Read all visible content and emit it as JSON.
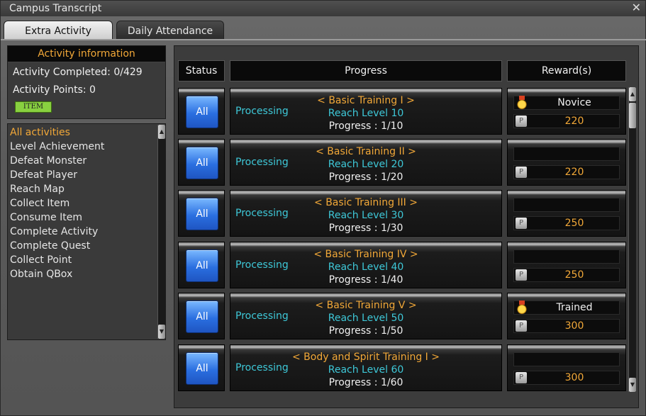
{
  "window": {
    "title": "Campus Transcript",
    "close_glyph": "✕"
  },
  "tabs": [
    {
      "label": "Extra Activity",
      "active": true
    },
    {
      "label": "Daily Attendance",
      "active": false
    }
  ],
  "info": {
    "header": "Activity information",
    "completed": "Activity Completed: 0/429",
    "points": "Activity Points: 0",
    "item_badge": "ITEM"
  },
  "categories": [
    "All activities",
    "Level Achievement",
    "Defeat Monster",
    "Defeat Player",
    "Reach Map",
    "Collect Item",
    "Consume Item",
    "Complete Activity",
    "Complete Quest",
    "Collect Point",
    "Obtain QBox"
  ],
  "table": {
    "headers": {
      "status": "Status",
      "progress": "Progress",
      "rewards": "Reward(s)"
    },
    "rows": [
      {
        "button": "All",
        "state": "Processing",
        "name": "< Basic Training I >",
        "goal": "Reach Level 10",
        "progress": "Progress : 1/10",
        "reward_title": "Novice",
        "reward_points": "220"
      },
      {
        "button": "All",
        "state": "Processing",
        "name": "< Basic Training II >",
        "goal": "Reach Level 20",
        "progress": "Progress : 1/20",
        "reward_title": "",
        "reward_points": "220"
      },
      {
        "button": "All",
        "state": "Processing",
        "name": "< Basic Training III >",
        "goal": "Reach Level 30",
        "progress": "Progress : 1/30",
        "reward_title": "",
        "reward_points": "250"
      },
      {
        "button": "All",
        "state": "Processing",
        "name": "< Basic Training IV >",
        "goal": "Reach Level 40",
        "progress": "Progress : 1/40",
        "reward_title": "",
        "reward_points": "250"
      },
      {
        "button": "All",
        "state": "Processing",
        "name": "< Basic Training V >",
        "goal": "Reach Level 50",
        "progress": "Progress : 1/50",
        "reward_title": "Trained",
        "reward_points": "300"
      },
      {
        "button": "All",
        "state": "Processing",
        "name": "< Body and Spirit Training I >",
        "goal": "Reach Level 60",
        "progress": "Progress : 1/60",
        "reward_title": "",
        "reward_points": "300"
      }
    ]
  },
  "icons": {
    "medal": "medal-icon",
    "points": "points-icon",
    "points_glyph": "P"
  },
  "colors": {
    "accent_orange": "#f2a838",
    "accent_cyan": "#3ec8d8",
    "button_blue": "#2a6fe0"
  }
}
